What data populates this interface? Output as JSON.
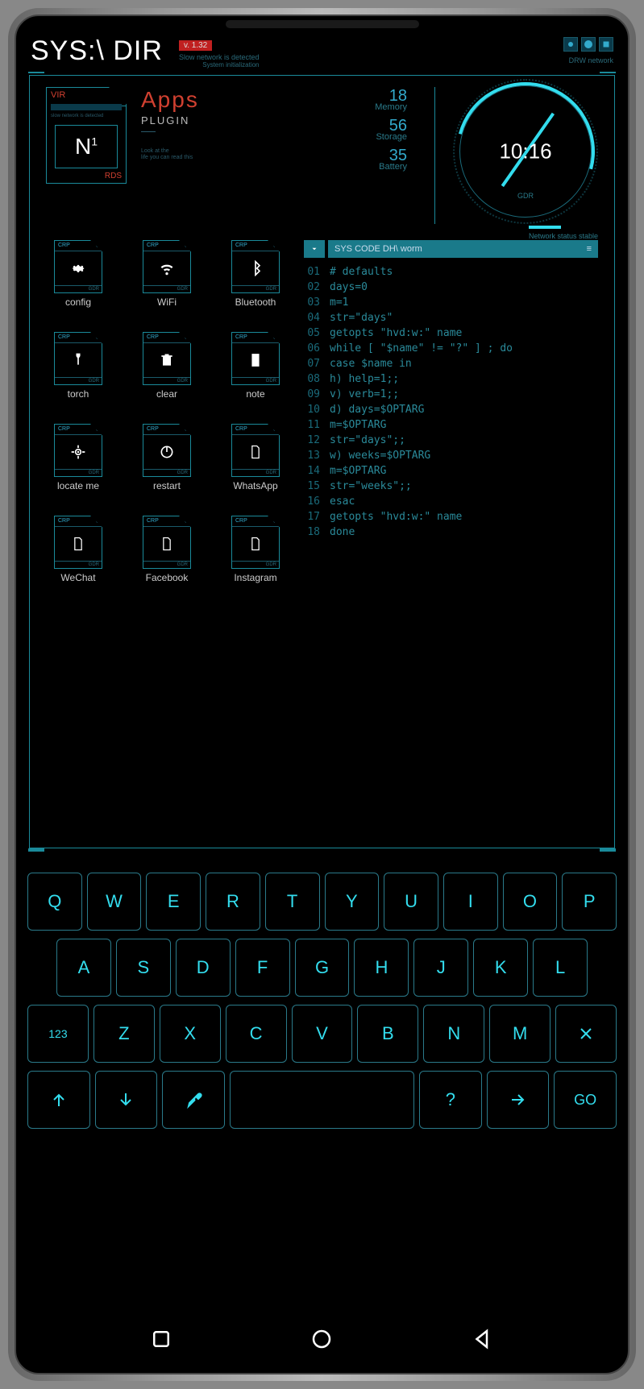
{
  "header": {
    "title": "SYS:\\ DIR",
    "version": "v. 1.32",
    "sub1": "Slow network is detected",
    "sub2": "System initialization",
    "net": "DRW network"
  },
  "ncard": {
    "vir": "VIR",
    "label": "N",
    "sup": "1",
    "rds": "RDS"
  },
  "apps": {
    "title": "Apps",
    "sub": "PLUGIN",
    "desc1": "Look at the",
    "desc2": "life you can read this"
  },
  "stats": {
    "memory_val": "18",
    "memory_lbl": "Memory",
    "storage_val": "56",
    "storage_lbl": "Storage",
    "battery_val": "35",
    "battery_lbl": "Battery"
  },
  "clock": {
    "time": "10:16",
    "gdr": "GDR"
  },
  "network": {
    "status": "Network status stable"
  },
  "code": {
    "title": "SYS CODE DH\\ worm",
    "lines": [
      "# defaults",
      "days=0",
      "m=1",
      "str=\"days\"",
      "getopts \"hvd:w:\" name",
      "while [ \"$name\" != \"?\" ] ; do",
      " case $name in",
      "  h) help=1;;",
      "  v) verb=1;;",
      "  d) days=$OPTARG",
      "    m=$OPTARG",
      "    str=\"days\";;",
      "  w) weeks=$OPTARG",
      "    m=$OPTARG",
      "    str=\"weeks\";;",
      "  esac",
      "  getopts \"hvd:w:\" name",
      "  done"
    ]
  },
  "app_items": [
    {
      "label": "config",
      "icon": "gear"
    },
    {
      "label": "WiFi",
      "icon": "wifi"
    },
    {
      "label": "Bluetooth",
      "icon": "bt"
    },
    {
      "label": "torch",
      "icon": "torch"
    },
    {
      "label": "clear",
      "icon": "trash"
    },
    {
      "label": "note",
      "icon": "note"
    },
    {
      "label": "locate me",
      "icon": "locate"
    },
    {
      "label": "restart",
      "icon": "power"
    },
    {
      "label": "WhatsApp",
      "icon": "file"
    },
    {
      "label": "WeChat",
      "icon": "file"
    },
    {
      "label": "Facebook",
      "icon": "file"
    },
    {
      "label": "Instagram",
      "icon": "file"
    }
  ],
  "icon_hdr": "CRP",
  "icon_ftr": "GDR",
  "kbd": {
    "r1": [
      "Q",
      "W",
      "E",
      "R",
      "T",
      "Y",
      "U",
      "I",
      "O",
      "P"
    ],
    "r2": [
      "A",
      "S",
      "D",
      "F",
      "G",
      "H",
      "J",
      "K",
      "L"
    ],
    "r3_num": "123",
    "r3": [
      "Z",
      "X",
      "C",
      "V",
      "B",
      "N",
      "M"
    ],
    "go": "GO",
    "q": "?"
  }
}
